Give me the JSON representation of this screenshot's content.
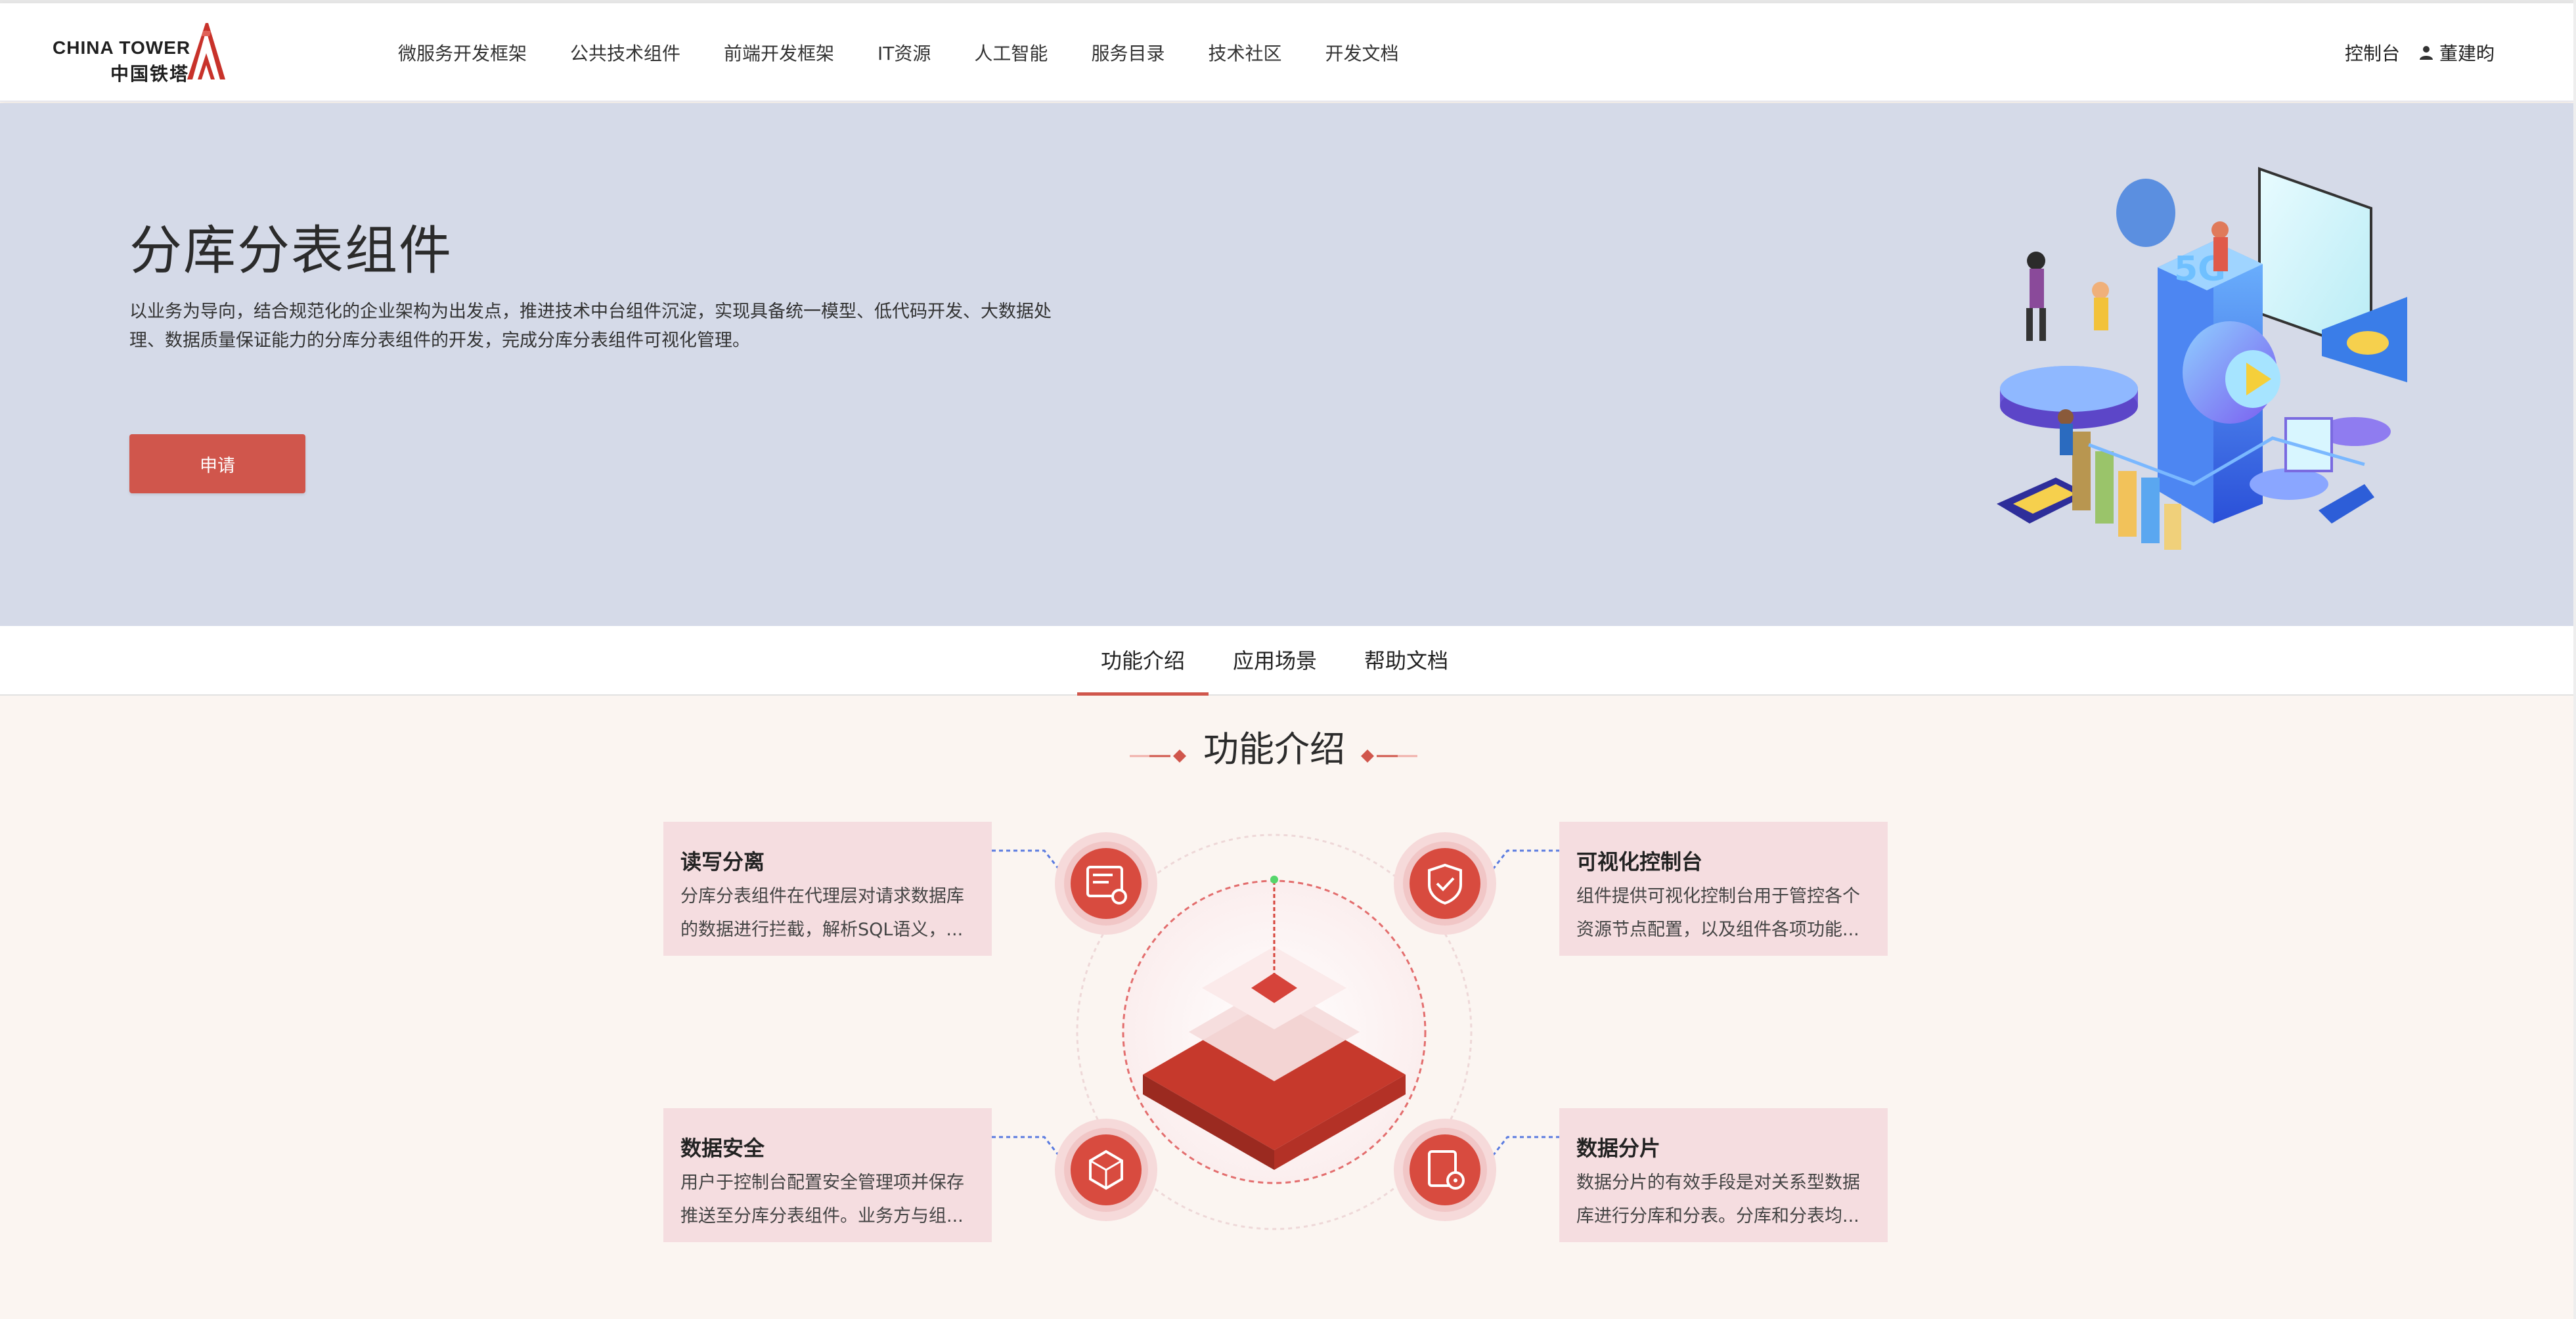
{
  "header": {
    "logo_en": "CHINA TOWER",
    "logo_cn": "中国铁塔",
    "nav": [
      "微服务开发框架",
      "公共技术组件",
      "前端开发框架",
      "IT资源",
      "人工智能",
      "服务目录",
      "技术社区",
      "开发文档"
    ],
    "console_label": "控制台",
    "user_name": "董建昀",
    "user_icon": "user-icon"
  },
  "hero": {
    "title": "分库分表组件",
    "desc_line1": "以业务为导向，结合规范化的企业架构为出发点，推进技术中台组件沉淀，实现具备统一模型、低代码开发、大数据处",
    "desc_line2": "理、数据质量保证能力的分库分表组件的开发，完成分库分表组件可视化管理。",
    "apply_label": "申请",
    "illustration_badge": "5G"
  },
  "tabs": [
    {
      "label": "功能介绍",
      "active": true
    },
    {
      "label": "应用场景",
      "active": false
    },
    {
      "label": "帮助文档",
      "active": false
    }
  ],
  "features": {
    "section_title": "功能介绍",
    "cards": [
      {
        "title": "读写分离",
        "line1": "分库分表组件在代理层对请求数据库",
        "line2": "的数据进行拦截，解析SQL语义，...",
        "icon": "document-user-icon"
      },
      {
        "title": "可视化控制台",
        "line1": "组件提供可视化控制台用于管控各个",
        "line2": "资源节点配置，以及组件各项功能...",
        "icon": "shield-check-icon"
      },
      {
        "title": "数据安全",
        "line1": "用户于控制台配置安全管理项并保存",
        "line2": "推送至分库分表组件。业务方与组...",
        "icon": "cube-network-icon"
      },
      {
        "title": "数据分片",
        "line1": "数据分片的有效手段是对关系型数据",
        "line2": "库进行分库和分表。分库和分表均...",
        "icon": "document-gear-icon"
      }
    ]
  },
  "colors": {
    "accent": "#d0564c",
    "hero_bg": "#d5dae8",
    "card_bg": "#f5dde0",
    "section_bg": "#fbf5f1"
  }
}
